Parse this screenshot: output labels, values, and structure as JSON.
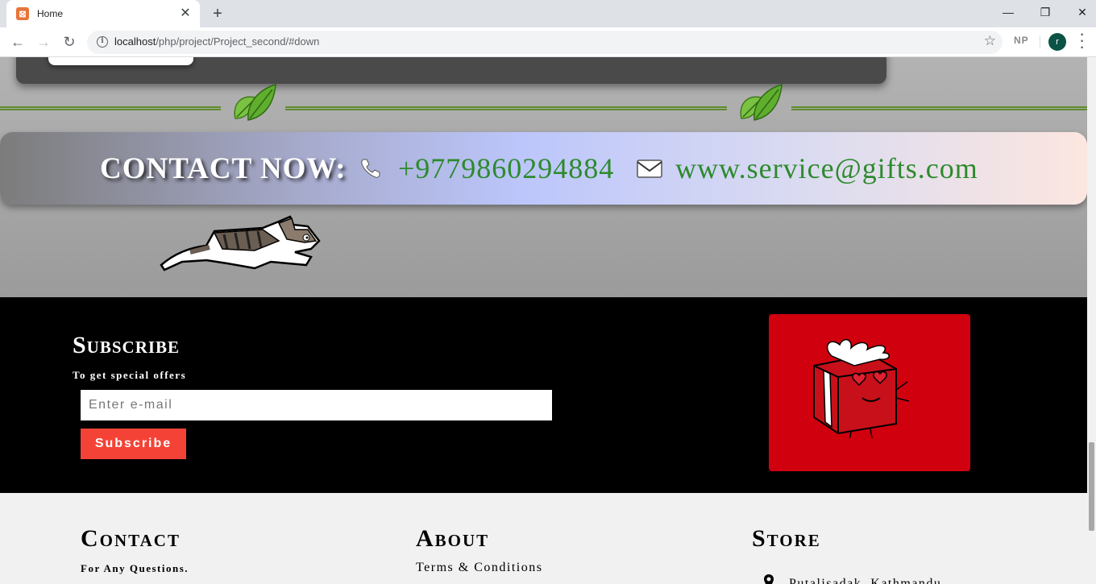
{
  "browser": {
    "tab_title": "Home",
    "url_host": "localhost",
    "url_path": "/php/project/Project_second/#down",
    "extension_label": "NP",
    "profile_initial": "r"
  },
  "contact_bar": {
    "label": "CONTACT NOW:",
    "phone": "+9779860294884",
    "email": "www.service@gifts.com",
    "text_color": "#2d8a2d"
  },
  "subscribe": {
    "title": "Subscribe",
    "description": "To get special offers",
    "input_placeholder": "Enter e-mail",
    "button_label": "Subscribe",
    "button_color": "#f44336",
    "gift_bg_color": "#d0000e"
  },
  "footer": {
    "contact": {
      "title": "Contact",
      "subtitle": "For Any Questions."
    },
    "about": {
      "title": "About",
      "link": "Terms & Conditions"
    },
    "store": {
      "title": "Store",
      "address": "Putalisadak, Kathmandu"
    }
  },
  "icons": {
    "phone": "phone-icon",
    "mail": "envelope-icon",
    "leaf": "leaf-icon",
    "pin": "map-pin-icon"
  }
}
